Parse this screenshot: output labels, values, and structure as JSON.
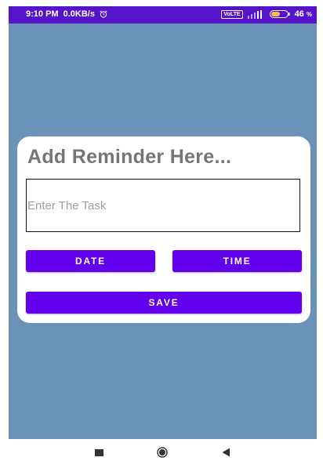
{
  "status_bar": {
    "time": "9:10 PM",
    "network_speed": "0.0KB/s",
    "alarm_icon": "alarm-clock-icon",
    "volte_label": "VoLTE",
    "battery_value": "46",
    "battery_unit": "%"
  },
  "dialog": {
    "title": "Add Reminder Here...",
    "task_placeholder": "Enter The Task",
    "task_value": "",
    "date_button": "DATE",
    "time_button": "TIME",
    "save_button": "SAVE"
  },
  "nav_bar": {
    "recent_icon": "recent-apps-icon",
    "home_icon": "home-icon",
    "back_icon": "back-icon"
  },
  "colors": {
    "status_bar": "#5514c9",
    "background": "#6b93b8",
    "accent": "#6200ee",
    "title_text": "#757575"
  }
}
